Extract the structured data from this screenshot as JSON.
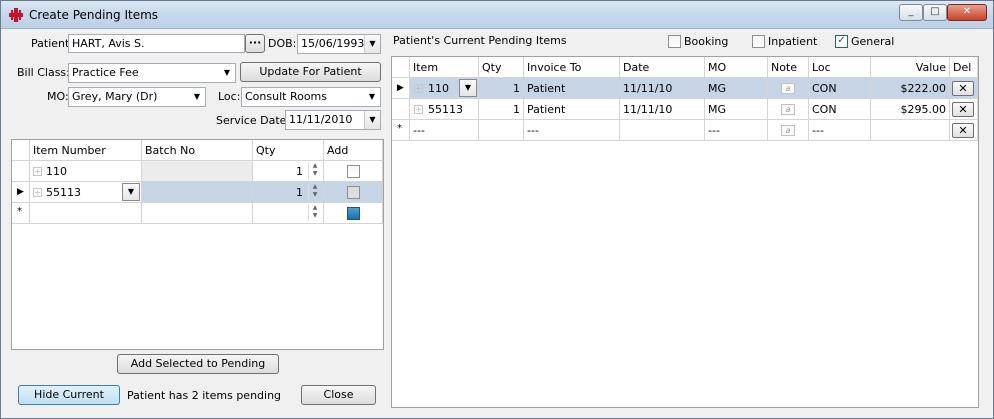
{
  "window": {
    "title": "Create Pending Items",
    "min": "_",
    "max": "□",
    "close": "✕"
  },
  "patient": {
    "label": "Patient:",
    "value": "HART, Avis S.",
    "ellipsis": "···",
    "dob_label": "DOB:",
    "dob_value": "15/06/1993"
  },
  "bill_class": {
    "label": "Bill Class:",
    "value": "Practice Fee"
  },
  "update_button": "Update For Patient",
  "mo": {
    "label": "MO:",
    "value": "Grey, Mary (Dr)"
  },
  "loc": {
    "label": "Loc:",
    "value": "Consult Rooms"
  },
  "service_date": {
    "label": "Service Date:",
    "value": "11/11/2010"
  },
  "left_grid": {
    "headers": [
      "Item Number",
      "Batch No",
      "Qty",
      "Add"
    ],
    "rows": [
      {
        "item": "110",
        "batch": "",
        "qty": "1"
      },
      {
        "item": "55113",
        "batch": "",
        "qty": "1"
      }
    ],
    "new_row_marker": "*"
  },
  "add_selected_button": "Add Selected to Pending",
  "hide_current_button": "Hide Current",
  "status_text": "Patient has 2 items pending",
  "close_button": "Close",
  "right": {
    "title": "Patient's Current Pending Items",
    "filters": [
      {
        "label": "Booking",
        "checked": false
      },
      {
        "label": "Inpatient",
        "checked": false
      },
      {
        "label": "General",
        "checked": true
      }
    ],
    "headers": [
      "Item",
      "Qty",
      "Invoice To",
      "Date",
      "MO",
      "Note",
      "Loc",
      "Value",
      "Del"
    ],
    "rows": [
      {
        "item": "110",
        "qty": "1",
        "invoice_to": "Patient",
        "date": "11/11/10",
        "mo": "MG",
        "note": "a",
        "loc": "CON",
        "value": "$222.00",
        "del": "✕"
      },
      {
        "item": "55113",
        "qty": "1",
        "invoice_to": "Patient",
        "date": "11/11/10",
        "mo": "MG",
        "note": "a",
        "loc": "CON",
        "value": "$295.00",
        "del": "✕"
      },
      {
        "item": "---",
        "qty": "",
        "invoice_to": "---",
        "date": "",
        "mo": "---",
        "note": "a",
        "loc": "---",
        "value": "",
        "del": "✕"
      }
    ],
    "new_row_marker": "*"
  }
}
